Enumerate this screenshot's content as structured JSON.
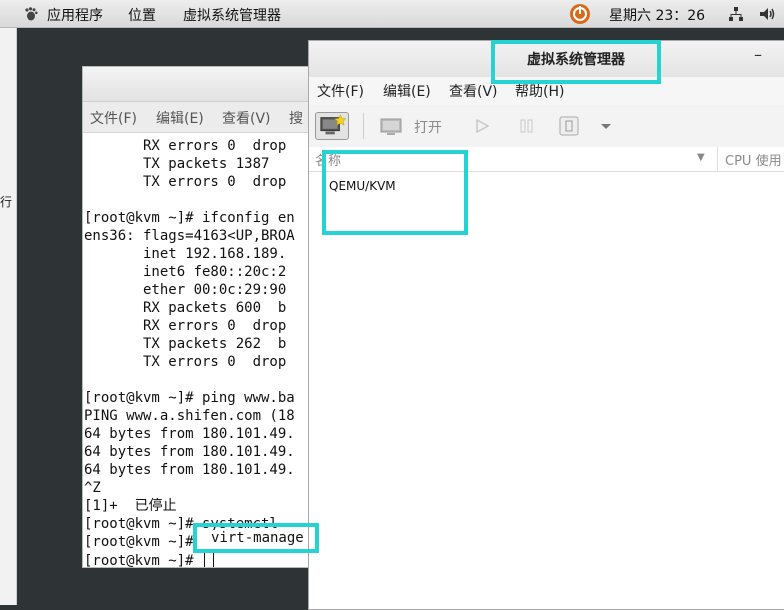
{
  "topbar": {
    "apps": "应用程序",
    "places": "位置",
    "active_app": "虚拟系统管理器",
    "clock": "星期六 23：26"
  },
  "left_edge": {
    "text": "行"
  },
  "terminal": {
    "menu": [
      "文件(F)",
      "编辑(E)",
      "查看(V)",
      "搜"
    ],
    "lines": [
      "       RX errors 0  drop",
      "       TX packets 1387  ",
      "       TX errors 0  drop",
      "",
      "[root@kvm ~]# ifconfig en",
      "ens36: flags=4163<UP,BROA",
      "       inet 192.168.189.",
      "       inet6 fe80::20c:2",
      "       ether 00:0c:29:90",
      "       RX packets 600  b",
      "       RX errors 0  drop",
      "       TX packets 262  b",
      "       TX errors 0  drop",
      "",
      "[root@kvm ~]# ping www.ba",
      "PING www.a.shifen.com (18",
      "64 bytes from 180.101.49.",
      "64 bytes from 180.101.49.",
      "64 bytes from 180.101.49.",
      "^Z",
      "[1]+  已停止",
      "[root@kvm ~]# systemctl ",
      "[root@kvm ~]#",
      "[root@kvm ~]# "
    ],
    "highlight_cmd": "virt-manage"
  },
  "vmm": {
    "title": "虚拟系统管理器",
    "minimize": "–",
    "menu": [
      "文件(F)",
      "编辑(E)",
      "查看(V)",
      "帮助(H)"
    ],
    "toolbar": {
      "open_label": "打开"
    },
    "columns": {
      "name": "名称",
      "cpu": "CPU 使用"
    },
    "connections": [
      "QEMU/KVM"
    ]
  }
}
